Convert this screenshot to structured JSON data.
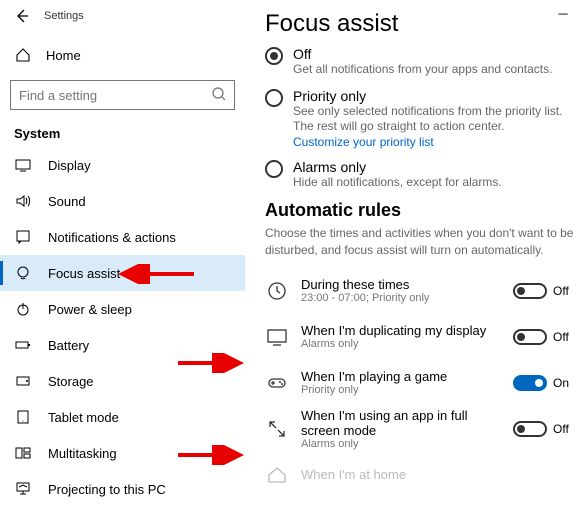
{
  "window": {
    "title": "Settings"
  },
  "sidebar": {
    "home": "Home",
    "search_placeholder": "Find a setting",
    "category": "System",
    "items": [
      {
        "icon": "display",
        "label": "Display"
      },
      {
        "icon": "sound",
        "label": "Sound"
      },
      {
        "icon": "notifications",
        "label": "Notifications & actions"
      },
      {
        "icon": "focus",
        "label": "Focus assist",
        "selected": true
      },
      {
        "icon": "power",
        "label": "Power & sleep"
      },
      {
        "icon": "battery",
        "label": "Battery"
      },
      {
        "icon": "storage",
        "label": "Storage"
      },
      {
        "icon": "tablet",
        "label": "Tablet mode"
      },
      {
        "icon": "multitask",
        "label": "Multitasking"
      },
      {
        "icon": "project",
        "label": "Projecting to this PC"
      }
    ]
  },
  "main": {
    "heading": "Focus assist",
    "radios": {
      "off": {
        "title": "Off",
        "desc": "Get all notifications from your apps and contacts."
      },
      "priority": {
        "title": "Priority only",
        "desc": "See only selected notifications from the priority list. The rest will go straight to action center.",
        "link": "Customize your priority list"
      },
      "alarms": {
        "title": "Alarms only",
        "desc": "Hide all notifications, except for alarms."
      }
    },
    "rules": {
      "heading": "Automatic rules",
      "desc": "Choose the times and activities when you don't want to be disturbed, and focus assist will turn on automatically.",
      "items": [
        {
          "title": "During these times",
          "sub": "23:00 - 07:00; Priority only",
          "state": "Off"
        },
        {
          "title": "When I'm duplicating my display",
          "sub": "Alarms only",
          "state": "Off"
        },
        {
          "title": "When I'm playing a game",
          "sub": "Priority only",
          "state": "On"
        },
        {
          "title": "When I'm using an app in full screen mode",
          "sub": "Alarms only",
          "state": "Off"
        },
        {
          "title": "When I'm at home",
          "sub": "",
          "state": ""
        }
      ]
    }
  }
}
